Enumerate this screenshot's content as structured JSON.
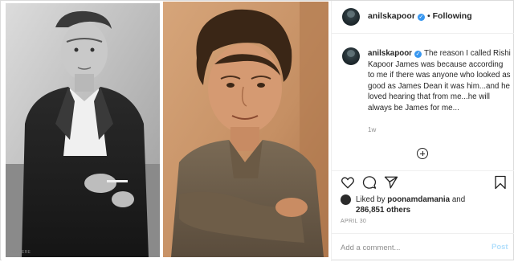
{
  "post": {
    "author": {
      "username": "anilskapoor",
      "verified": true,
      "follow_status": "Following",
      "separator": "•"
    },
    "caption": {
      "username": "anilskapoor",
      "text": "The reason I called Rishi Kapoor James was because according to me if there was anyone who looked as good as James Dean it was him...and he loved hearing that from me...he will always be James for me..."
    },
    "time_ago": "1w",
    "load_more_icon": "plus-circle-icon",
    "actions": {
      "icons": [
        "heart-icon",
        "comment-icon",
        "share-icon",
        "bookmark-icon"
      ]
    },
    "likes": {
      "prefix": "Liked by",
      "liked_by_user": "poonamdamania",
      "conjunction": "and",
      "others_count": "286,851 others"
    },
    "date": "APRIL 30",
    "add_comment": {
      "placeholder": "Add a comment...",
      "post_label": "Post"
    },
    "media": {
      "watermark": "HIWHERE",
      "left_image": "black-and-white portrait of man in leather jacket",
      "right_image": "color portrait of man with curly hair"
    },
    "colors": {
      "verified_blue": "#3897f0",
      "post_button_disabled": "#b2dffc",
      "border": "#dbdbdb",
      "muted_text": "#8e8e8e"
    }
  }
}
